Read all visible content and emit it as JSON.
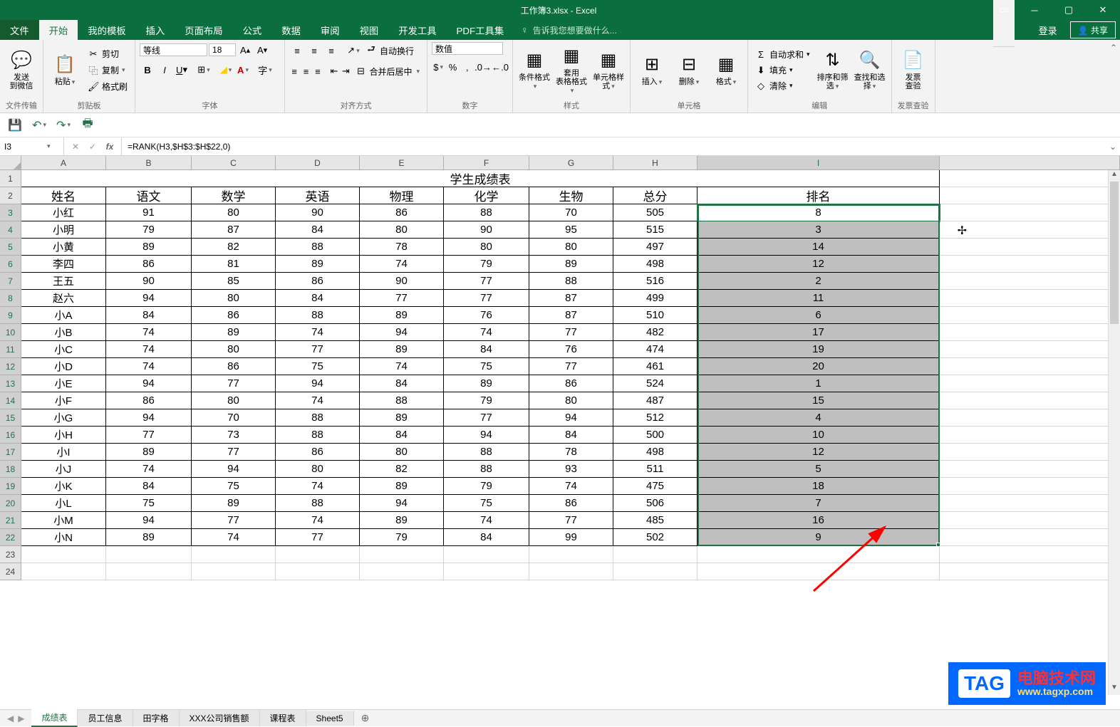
{
  "window": {
    "title": "工作簿3.xlsx - Excel",
    "login": "登录",
    "share": "共享"
  },
  "tabs": {
    "file": "文件",
    "home": "开始",
    "templates": "我的模板",
    "insert": "插入",
    "layout": "页面布局",
    "formulas": "公式",
    "data": "数据",
    "review": "审阅",
    "view": "视图",
    "developer": "开发工具",
    "pdf": "PDF工具集",
    "tellme": "告诉我您想要做什么..."
  },
  "ribbon": {
    "send": {
      "label": "发送\n到微信",
      "group": "文件传输"
    },
    "clipboard": {
      "label": "粘贴",
      "cut": "剪切",
      "copy": "复制",
      "format_painter": "格式刷",
      "group": "剪贴板"
    },
    "font": {
      "name": "等线",
      "size": "18",
      "group": "字体"
    },
    "align": {
      "wrap": "自动换行",
      "merge": "合并后居中",
      "group": "对齐方式"
    },
    "number": {
      "format": "数值",
      "group": "数字"
    },
    "styles": {
      "cond": "条件格式",
      "table": "套用\n表格格式",
      "cell": "单元格样式",
      "group": "样式"
    },
    "cells": {
      "insert": "插入",
      "delete": "删除",
      "format": "格式",
      "group": "单元格"
    },
    "editing": {
      "sum": "自动求和",
      "fill": "填充",
      "clear": "清除",
      "sort": "排序和筛选",
      "find": "查找和选择",
      "group": "编辑"
    },
    "invoice": {
      "label": "发票\n查验",
      "group": "发票查验"
    }
  },
  "namebox": "I3",
  "formula": "=RANK(H3,$H$3:$H$22,0)",
  "columns": [
    "A",
    "B",
    "C",
    "D",
    "E",
    "F",
    "G",
    "H",
    "I"
  ],
  "title_cell": "学生成绩表",
  "headers": [
    "姓名",
    "语文",
    "数学",
    "英语",
    "物理",
    "化学",
    "生物",
    "总分",
    "排名"
  ],
  "rows": [
    [
      "小红",
      "91",
      "80",
      "90",
      "86",
      "88",
      "70",
      "505",
      "8"
    ],
    [
      "小明",
      "79",
      "87",
      "84",
      "80",
      "90",
      "95",
      "515",
      "3"
    ],
    [
      "小黄",
      "89",
      "82",
      "88",
      "78",
      "80",
      "80",
      "497",
      "14"
    ],
    [
      "李四",
      "86",
      "81",
      "89",
      "74",
      "79",
      "89",
      "498",
      "12"
    ],
    [
      "王五",
      "90",
      "85",
      "86",
      "90",
      "77",
      "88",
      "516",
      "2"
    ],
    [
      "赵六",
      "94",
      "80",
      "84",
      "77",
      "77",
      "87",
      "499",
      "11"
    ],
    [
      "小A",
      "84",
      "86",
      "88",
      "89",
      "76",
      "87",
      "510",
      "6"
    ],
    [
      "小B",
      "74",
      "89",
      "74",
      "94",
      "74",
      "77",
      "482",
      "17"
    ],
    [
      "小C",
      "74",
      "80",
      "77",
      "89",
      "84",
      "76",
      "474",
      "19"
    ],
    [
      "小D",
      "74",
      "86",
      "75",
      "74",
      "75",
      "77",
      "461",
      "20"
    ],
    [
      "小E",
      "94",
      "77",
      "94",
      "84",
      "89",
      "86",
      "524",
      "1"
    ],
    [
      "小F",
      "86",
      "80",
      "74",
      "88",
      "79",
      "80",
      "487",
      "15"
    ],
    [
      "小G",
      "94",
      "70",
      "88",
      "89",
      "77",
      "94",
      "512",
      "4"
    ],
    [
      "小H",
      "77",
      "73",
      "88",
      "84",
      "94",
      "84",
      "500",
      "10"
    ],
    [
      "小I",
      "89",
      "77",
      "86",
      "80",
      "88",
      "78",
      "498",
      "12"
    ],
    [
      "小J",
      "74",
      "94",
      "80",
      "82",
      "88",
      "93",
      "511",
      "5"
    ],
    [
      "小K",
      "84",
      "75",
      "74",
      "89",
      "79",
      "74",
      "475",
      "18"
    ],
    [
      "小L",
      "75",
      "89",
      "88",
      "94",
      "75",
      "86",
      "506",
      "7"
    ],
    [
      "小M",
      "94",
      "77",
      "74",
      "89",
      "74",
      "77",
      "485",
      "16"
    ],
    [
      "小N",
      "89",
      "74",
      "77",
      "79",
      "84",
      "99",
      "502",
      "9"
    ]
  ],
  "sheet_tabs": [
    "成绩表",
    "员工信息",
    "田字格",
    "XXX公司销售额",
    "课程表",
    "Sheet5"
  ],
  "watermark": {
    "tag": "TAG",
    "text": "电脑技术网",
    "url": "www.tagxp.com"
  }
}
